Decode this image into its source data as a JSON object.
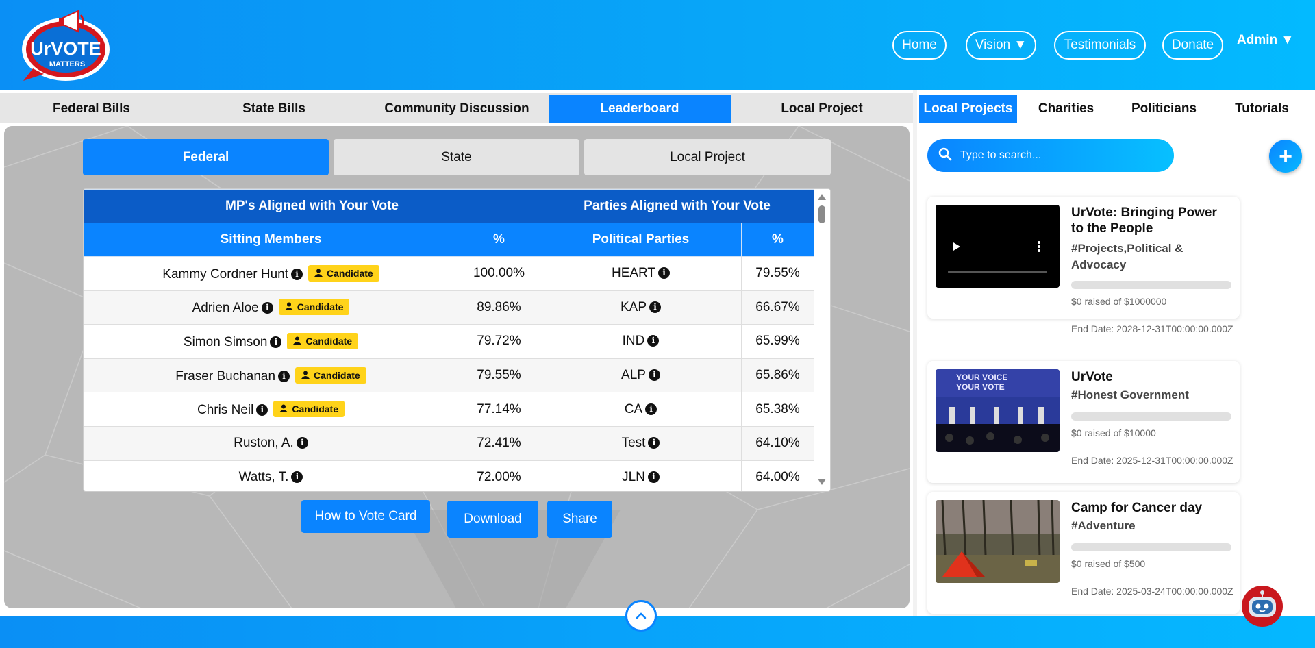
{
  "brand": {
    "logo_line1": "UrVOTE",
    "logo_line2": "MATTERS"
  },
  "nav": {
    "home": "Home",
    "vision": "Vision ▼",
    "testimonials": "Testimonials",
    "donate": "Donate",
    "admin": "Admin ▼"
  },
  "main_tabs": [
    "Federal Bills",
    "State Bills",
    "Community Discussion",
    "Leaderboard",
    "Local Project"
  ],
  "seg_tabs": [
    "Federal",
    "State",
    "Local Project"
  ],
  "table": {
    "group_headers": [
      "MP's Aligned with Your Vote",
      "Parties Aligned with Your Vote"
    ],
    "col_headers": [
      "Sitting Members",
      "%",
      "Political Parties",
      "%"
    ],
    "candidate_label": "Candidate",
    "rows": [
      {
        "member": "Kammy Cordner Hunt",
        "candidate": true,
        "pct": "100.00%",
        "party": "HEART",
        "party_pct": "79.55%"
      },
      {
        "member": "Adrien Aloe",
        "candidate": true,
        "pct": "89.86%",
        "party": "KAP",
        "party_pct": "66.67%"
      },
      {
        "member": "Simon Simson",
        "candidate": true,
        "pct": "79.72%",
        "party": "IND",
        "party_pct": "65.99%"
      },
      {
        "member": "Fraser Buchanan",
        "candidate": true,
        "pct": "79.55%",
        "party": "ALP",
        "party_pct": "65.86%"
      },
      {
        "member": "Chris Neil",
        "candidate": true,
        "pct": "77.14%",
        "party": "CA",
        "party_pct": "65.38%"
      },
      {
        "member": "Ruston, A.",
        "candidate": false,
        "pct": "72.41%",
        "party": "Test",
        "party_pct": "64.10%"
      },
      {
        "member": "Watts, T.",
        "candidate": false,
        "pct": "72.00%",
        "party": "JLN",
        "party_pct": "64.00%"
      }
    ]
  },
  "actions": {
    "how_to": "How to Vote Card",
    "download": "Download",
    "share": "Share"
  },
  "right_tabs": [
    "Local Projects",
    "Charities",
    "Politicians",
    "Tutorials"
  ],
  "search": {
    "placeholder": "Type to search..."
  },
  "projects": [
    {
      "title": "UrVote: Bringing Power to the People",
      "tags": "#Projects,Political & Advocacy",
      "raised": "$0 raised of $1000000",
      "end": "End Date: 2028-12-31T00:00:00.000Z",
      "progress": 0
    },
    {
      "title": "UrVote",
      "tags": "#Honest Government",
      "raised": "$0 raised of $10000",
      "end": "End Date: 2025-12-31T00:00:00.000Z",
      "progress": 0
    },
    {
      "title": "Camp for Cancer day",
      "tags": "#Adventure",
      "raised": "$0 raised of $500",
      "end": "End Date: 2025-03-24T00:00:00.000Z",
      "progress": 0
    }
  ],
  "colors": {
    "primary": "#0a84ff",
    "header_dark": "#0b5cc7",
    "badge": "#ffd31a"
  }
}
